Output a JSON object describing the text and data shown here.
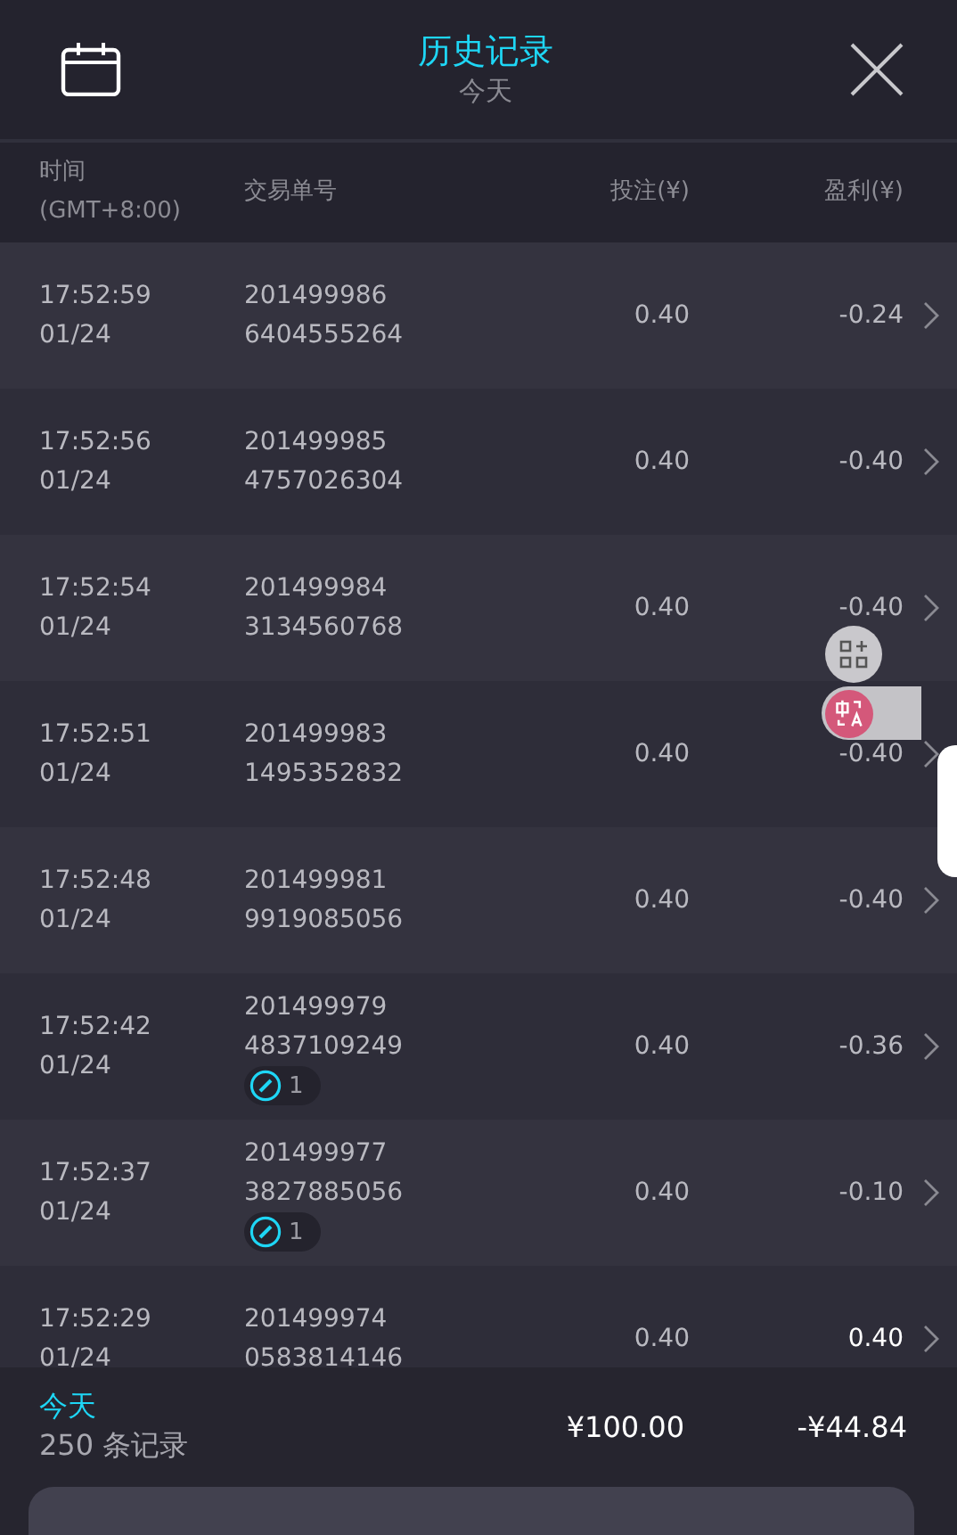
{
  "header": {
    "title": "历史记录",
    "subtitle": "今天"
  },
  "columns": [
    {
      "label": "时间",
      "sub": "(GMT+8:00)"
    },
    {
      "label": "交易单号"
    },
    {
      "label": "投注(¥)"
    },
    {
      "label": "盈利(¥)"
    }
  ],
  "rows": [
    {
      "time": "17:52:59",
      "date": "01/24",
      "id1": "201499986",
      "id2": "6404555264",
      "stake": "0.40",
      "profit": "-0.24",
      "win": false
    },
    {
      "time": "17:52:56",
      "date": "01/24",
      "id1": "201499985",
      "id2": "4757026304",
      "stake": "0.40",
      "profit": "-0.40",
      "win": false
    },
    {
      "time": "17:52:54",
      "date": "01/24",
      "id1": "201499984",
      "id2": "3134560768",
      "stake": "0.40",
      "profit": "-0.40",
      "win": false
    },
    {
      "time": "17:52:51",
      "date": "01/24",
      "id1": "201499983",
      "id2": "1495352832",
      "stake": "0.40",
      "profit": "-0.40",
      "win": false
    },
    {
      "time": "17:52:48",
      "date": "01/24",
      "id1": "201499981",
      "id2": "9919085056",
      "stake": "0.40",
      "profit": "-0.40",
      "win": false
    },
    {
      "time": "17:52:42",
      "date": "01/24",
      "id1": "201499979",
      "id2": "4837109249",
      "badge": "1",
      "stake": "0.40",
      "profit": "-0.36",
      "win": false
    },
    {
      "time": "17:52:37",
      "date": "01/24",
      "id1": "201499977",
      "id2": "3827885056",
      "badge": "1",
      "stake": "0.40",
      "profit": "-0.10",
      "win": false
    },
    {
      "time": "17:52:29",
      "date": "01/24",
      "id1": "201499974",
      "id2": "0583814146",
      "stake": "0.40",
      "profit": "0.40",
      "win": true
    }
  ],
  "footer": {
    "period": "今天",
    "count": "250 条记录",
    "stake_total": "¥100.00",
    "profit_total": "-¥44.84"
  }
}
